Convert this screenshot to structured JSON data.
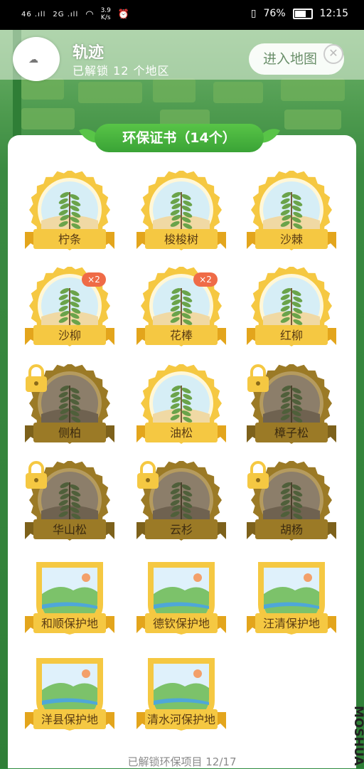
{
  "status_bar": {
    "signal1": "46 .ıll",
    "signal2": "2G .ıll",
    "net_speed_value": "3.9",
    "net_speed_unit": "K/s",
    "battery": "76%",
    "time": "12:15"
  },
  "header": {
    "avatar_text": "☁",
    "username": "轨迹",
    "unlocked_text": "已解锁 12 个地区",
    "enter_map_label": "进入地图"
  },
  "certificate": {
    "title": "环保证书（14个）"
  },
  "badges": [
    {
      "label": "柠条",
      "locked": false,
      "count": ""
    },
    {
      "label": "梭梭树",
      "locked": false,
      "count": ""
    },
    {
      "label": "沙棘",
      "locked": false,
      "count": ""
    },
    {
      "label": "沙柳",
      "locked": false,
      "count": "×2"
    },
    {
      "label": "花棒",
      "locked": false,
      "count": "×2"
    },
    {
      "label": "红柳",
      "locked": false,
      "count": ""
    },
    {
      "label": "侧柏",
      "locked": true,
      "count": ""
    },
    {
      "label": "油松",
      "locked": false,
      "count": ""
    },
    {
      "label": "樟子松",
      "locked": true,
      "count": ""
    },
    {
      "label": "华山松",
      "locked": true,
      "count": ""
    },
    {
      "label": "云杉",
      "locked": true,
      "count": ""
    },
    {
      "label": "胡杨",
      "locked": true,
      "count": ""
    },
    {
      "label": "和顺保护地",
      "locked": false,
      "count": ""
    },
    {
      "label": "德钦保护地",
      "locked": false,
      "count": ""
    },
    {
      "label": "汪清保护地",
      "locked": false,
      "count": ""
    },
    {
      "label": "洋县保护地",
      "locked": false,
      "count": ""
    },
    {
      "label": "清水河保护地",
      "locked": false,
      "count": ""
    }
  ],
  "footer": {
    "text": "已解锁环保项目 12/17"
  },
  "watermark": "MOSHUA",
  "colors": {
    "gold": "#f5c842",
    "gold_dark": "#e3a51c",
    "locked": "#9b7a26",
    "ribbon_green": "#3aa336",
    "count_badge": "#ef6b47"
  }
}
